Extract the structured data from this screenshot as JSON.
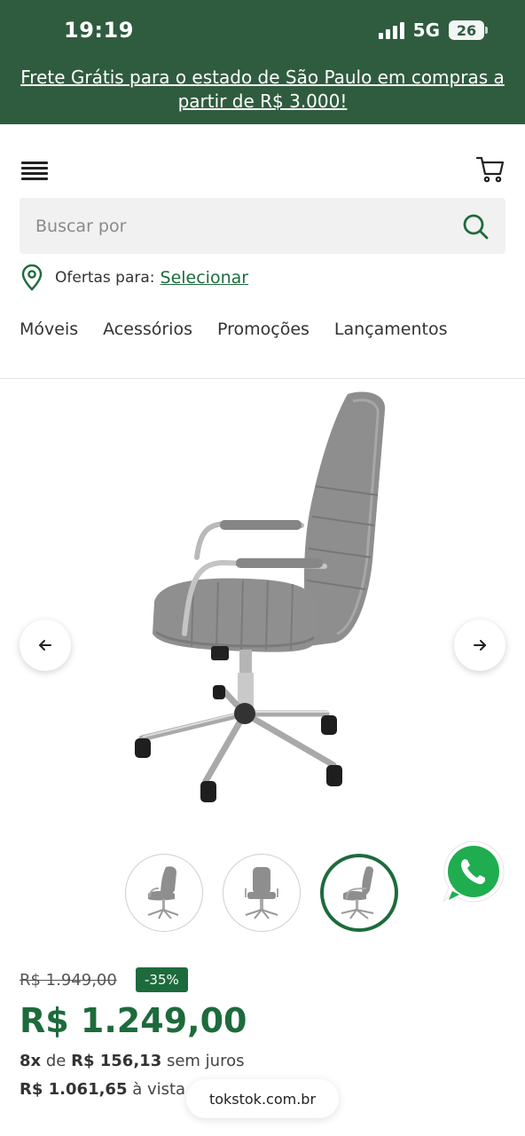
{
  "status_bar": {
    "time": "19:19",
    "network": "5G",
    "battery": "26"
  },
  "promo_banner": {
    "text": "Frete Grátis para o estado de São Paulo em compras a partir de R$ 3.000!"
  },
  "search": {
    "placeholder": "Buscar por"
  },
  "location": {
    "label": "Ofertas para:",
    "link": "Selecionar"
  },
  "nav": {
    "items": [
      "Móveis",
      "Acessórios",
      "Promoções",
      "Lançamentos"
    ]
  },
  "product": {
    "old_price": "R$ 1.949,00",
    "discount": "-35%",
    "price": "R$ 1.249,00",
    "installments": {
      "count": "8x",
      "de": "de",
      "value": "R$ 156,13",
      "suffix": "sem juros"
    },
    "cash": {
      "value": "R$ 1.061,65",
      "suffix": "à vista"
    }
  },
  "browser": {
    "url": "tokstok.com.br"
  },
  "colors": {
    "brand_green": "#2f5c3e",
    "accent_green": "#1d6b3c"
  }
}
